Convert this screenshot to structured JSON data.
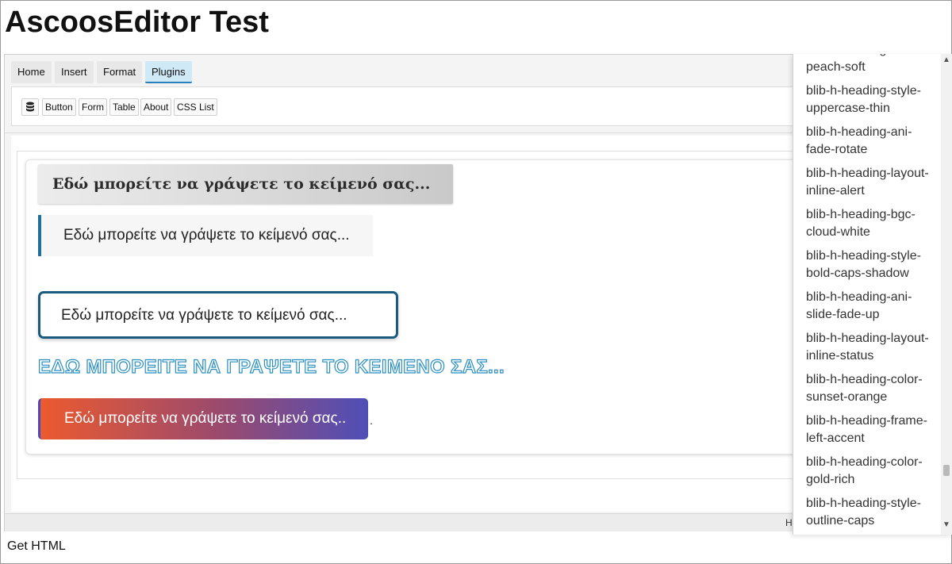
{
  "page": {
    "title": "AscoosEditor Test",
    "get_html_label": "Get HTML"
  },
  "editor": {
    "tabs": [
      {
        "label": "Home"
      },
      {
        "label": "Insert"
      },
      {
        "label": "Format"
      },
      {
        "label": "Plugins",
        "active": true
      }
    ],
    "toolbar": {
      "database_icon": "database-icon",
      "buttons": [
        "Button",
        "Form",
        "Table",
        "About",
        "CSS List"
      ]
    },
    "headings": [
      "Εδώ μπορείτε να γράψετε το κείμενό σας...",
      "Εδώ μπορείτε να γράψετε το κείμενό σας...",
      "Εδώ μπορείτε να γράψετε το κείμενό σας...",
      "ΕΔΩ ΜΠΟΡΕΙΤΕ ΝΑ ΓΡΑΨΕΤΕ ΤΟ ΚΕΙΜΕΝΟ ΣΑΣ...",
      "Εδώ μπορείτε να γράψετε το κείμενό σας.."
    ],
    "trailing_dot": ".",
    "status_text": "H"
  },
  "css_list_panel": {
    "items": [
      "blib-h-heading-color-peach-soft",
      "blib-h-heading-style-uppercase-thin",
      "blib-h-heading-ani-fade-rotate",
      "blib-h-heading-layout-inline-alert",
      "blib-h-heading-bgc-cloud-white",
      "blib-h-heading-style-bold-caps-shadow",
      "blib-h-heading-ani-slide-fade-up",
      "blib-h-heading-layout-inline-status",
      "blib-h-heading-color-sunset-orange",
      "blib-h-heading-frame-left-accent",
      "blib-h-heading-color-gold-rich",
      "blib-h-heading-style-outline-caps"
    ]
  },
  "colors": {
    "accent": "#2d7fb8",
    "frame_border": "#1b5b7e",
    "gradient_start": "#ec5a2f",
    "gradient_end": "#4f4fb8"
  }
}
